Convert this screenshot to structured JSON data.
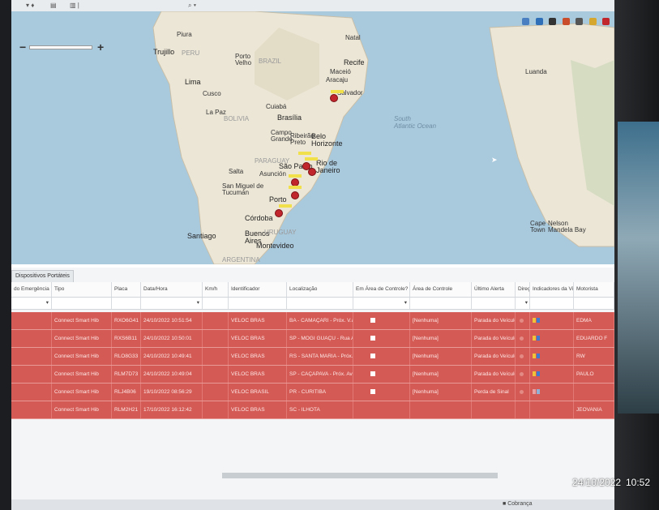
{
  "map": {
    "labels": {
      "piura": "Piura",
      "trujillo": "Trujillo",
      "peru": "PERU",
      "lima": "Lima",
      "cusco": "Cusco",
      "la_paz": "La Paz",
      "bolivia": "BOLIVIA",
      "porto_velho": "Porto\nVelho",
      "brazil": "BRAZIL",
      "natal": "Natal",
      "recife": "Recife",
      "maceio": "Maceió",
      "aracaju": "Aracaju",
      "salvador": "Salvador",
      "cuiaba": "Cuiabá",
      "brasilia": "Brasília",
      "campo_grande": "Campo\nGrande",
      "ribeirao_preto": "Ribeirão\nPreto",
      "belo_horizonte": "Belo\nHorizonte",
      "paraguay": "PARAGUAY",
      "salta": "Salta",
      "asuncion": "Asunción",
      "sao_paulo": "São Paulo",
      "rio": "Rio de\nJaneiro",
      "tucuman": "San Miguel de\nTucumán",
      "porto": "Porto",
      "cordoba": "Córdoba",
      "santiago": "Santiago",
      "buenos_aires": "Buenos\nAires",
      "montevideo": "Montevideo",
      "uruguay": "URUGUAY",
      "argentina": "ARGENTINA",
      "south_atlantic": "South\nAtlantic Ocean",
      "luanda": "Luanda",
      "cape_town": "Cape\nTown",
      "nelson_mandela_bay": "Nelson\nMandela Bay"
    }
  },
  "panel": {
    "tab_label": "Dispositivos Portáteis",
    "columns": [
      "do Emergência",
      "Tipo",
      "Placa",
      "Data/Hora",
      "Km/h",
      "Identificador",
      "Localização",
      "Em Área de Controle?",
      "Área de Controle",
      "Último Alerta",
      "Direção",
      "Indicadores da Viagem",
      "Motorista"
    ],
    "rows": [
      {
        "tipo": "Connect Smart Hib",
        "placa": "RXO6G41",
        "datahora": "24/10/2022 10:51:54",
        "identificador": "VELOC BRAS",
        "localizacao": "BA - CAMAÇARI - Próx. V.a de U",
        "area": "[Nenhuma]",
        "alerta": "Parada do Veículo",
        "motorista": "EDMA"
      },
      {
        "tipo": "Connect Smart Hib",
        "placa": "RXS6B11",
        "datahora": "24/10/2022 10:50:01",
        "identificador": "VELOC BRAS",
        "localizacao": "SP - MOGI GUAÇU - Rua Antôno",
        "area": "[Nenhuma]",
        "alerta": "Parada do Veículo",
        "motorista": "EDUARDO F"
      },
      {
        "tipo": "Connect Smart Hib",
        "placa": "RLO8G33",
        "datahora": "24/10/2022 10:49:41",
        "identificador": "VELOC BRAS",
        "localizacao": "RS - SANTA MARIA - Próx. Rua C",
        "area": "[Nenhuma]",
        "alerta": "Parada do Veículo",
        "motorista": "RW"
      },
      {
        "tipo": "Connect Smart Hib",
        "placa": "RLM7D73",
        "datahora": "24/10/2022 10:49:04",
        "identificador": "VELOC BRAS",
        "localizacao": "SP - CAÇAPAVA - Próx. Avenida I",
        "area": "[Nenhuma]",
        "alerta": "Parada do Veículo",
        "motorista": "PAULO"
      },
      {
        "tipo": "Connect Smart Hib",
        "placa": "RLJ4B06",
        "datahora": "19/10/2022 08:56:29",
        "identificador": "VELOC BRASIL",
        "localizacao": "PR - CURITIBA",
        "area": "[Nenhuma]",
        "alerta": "Perda de Sinal",
        "motorista": ""
      },
      {
        "tipo": "Connect Smart Hib",
        "placa": "RLM2H21",
        "datahora": "17/10/2022 16:12:42",
        "identificador": "VELOC BRAS",
        "localizacao": "SC - ILHOTA",
        "area": "[Nenhuma]",
        "alerta": "O veículo está ling",
        "motorista": "JEOVANIA"
      }
    ],
    "filter_dropdown_arrow": "▾"
  },
  "taskbar": {
    "time": "10:52",
    "date": "24/10/2022"
  },
  "statusbar": {
    "item": "Cobrança"
  },
  "colors": {
    "row_alert": "#d45a55",
    "map_ocean": "#a9c9dd",
    "land": "#ece6d6"
  }
}
